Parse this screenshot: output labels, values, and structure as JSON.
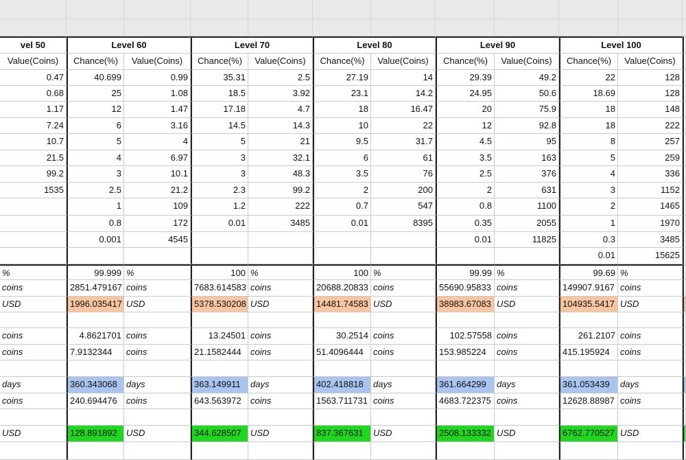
{
  "colors": {
    "header_bg": "#e9e9e9",
    "usd_highlight": "#f7c59f",
    "days_highlight": "#a9c4ee",
    "final_usd_highlight": "#1ed81e",
    "grid_line": "#c9c9c9"
  },
  "units": {
    "percent": "%",
    "coins": "coins",
    "usd": "USD",
    "days": "days"
  },
  "sheet": {
    "partial_level_label": "vel 50",
    "partial_value_header": "Value(Coins)",
    "partial_values": [
      "0.47",
      "0.68",
      "1.17",
      "7.24",
      "10.7",
      "21.5",
      "99.2",
      "1535"
    ],
    "chance_header": "Chance(%)",
    "value_header": "Value(Coins)",
    "levels": [
      {
        "label": "Level 60",
        "rows": [
          [
            "40.699",
            "0.99"
          ],
          [
            "25",
            "1.08"
          ],
          [
            "12",
            "1.47"
          ],
          [
            "6",
            "3.16"
          ],
          [
            "5",
            "4"
          ],
          [
            "4",
            "6.97"
          ],
          [
            "3",
            "10.1"
          ],
          [
            "2.5",
            "21.2"
          ],
          [
            "1",
            "109"
          ],
          [
            "0.8",
            "172"
          ],
          [
            "0.001",
            "4545"
          ],
          [
            "",
            ""
          ]
        ],
        "total_chance": "99.999",
        "coins_total": "2851.479167",
        "usd_total": "1996.035417",
        "coins_a": "4.8621701",
        "coins_b": "7.9132344",
        "days": "360.343068",
        "coins_c": "240.694476",
        "final_usd": "128.891892"
      },
      {
        "label": "Level 70",
        "rows": [
          [
            "35.31",
            "2.5"
          ],
          [
            "18.5",
            "3.92"
          ],
          [
            "17.18",
            "4.7"
          ],
          [
            "14.5",
            "14.3"
          ],
          [
            "5",
            "21"
          ],
          [
            "3",
            "32.1"
          ],
          [
            "3",
            "48.3"
          ],
          [
            "2.3",
            "99.2"
          ],
          [
            "1.2",
            "222"
          ],
          [
            "0.01",
            "3485"
          ],
          [
            "",
            ""
          ],
          [
            "",
            ""
          ]
        ],
        "total_chance": "100",
        "coins_total": "7683.614583",
        "usd_total": "5378.530208",
        "coins_a": "13.24501",
        "coins_b": "21.1582444",
        "days": "363.149911",
        "coins_c": "643.563972",
        "final_usd": "344.628507"
      },
      {
        "label": "Level 80",
        "rows": [
          [
            "27.19",
            "14"
          ],
          [
            "23.1",
            "14.2"
          ],
          [
            "18",
            "16.47"
          ],
          [
            "10",
            "22"
          ],
          [
            "9.5",
            "31.7"
          ],
          [
            "6",
            "61"
          ],
          [
            "3.5",
            "76"
          ],
          [
            "2",
            "200"
          ],
          [
            "0.7",
            "547"
          ],
          [
            "0.01",
            "8395"
          ],
          [
            "",
            ""
          ],
          [
            "",
            ""
          ]
        ],
        "total_chance": "100",
        "coins_total": "20688.20833",
        "usd_total": "14481.74583",
        "coins_a": "30.2514",
        "coins_b": "51.4096444",
        "days": "402.418818",
        "coins_c": "1563.711731",
        "final_usd": "837.367631"
      },
      {
        "label": "Level 90",
        "rows": [
          [
            "29.39",
            "49.2"
          ],
          [
            "24.95",
            "50.6"
          ],
          [
            "20",
            "75.9"
          ],
          [
            "12",
            "92.8"
          ],
          [
            "4.5",
            "95"
          ],
          [
            "3.5",
            "163"
          ],
          [
            "2.5",
            "376"
          ],
          [
            "2",
            "631"
          ],
          [
            "0.8",
            "1100"
          ],
          [
            "0.35",
            "2055"
          ],
          [
            "0.01",
            "11825"
          ],
          [
            "",
            ""
          ]
        ],
        "total_chance": "99.99",
        "coins_total": "55690.95833",
        "usd_total": "38983.67083",
        "coins_a": "102.57558",
        "coins_b": "153.985224",
        "days": "361.664299",
        "coins_c": "4683.722375",
        "final_usd": "2508.133332"
      },
      {
        "label": "Level 100",
        "rows": [
          [
            "22",
            "128"
          ],
          [
            "18.69",
            "128"
          ],
          [
            "18",
            "148"
          ],
          [
            "18",
            "222"
          ],
          [
            "8",
            "257"
          ],
          [
            "5",
            "259"
          ],
          [
            "4",
            "336"
          ],
          [
            "3",
            "1152"
          ],
          [
            "2",
            "1465"
          ],
          [
            "1",
            "1970"
          ],
          [
            "0.3",
            "3485"
          ],
          [
            "0.01",
            "15625"
          ]
        ],
        "total_chance": "99.69",
        "coins_total": "149907.9167",
        "usd_total": "104935.5417",
        "coins_a": "261.2107",
        "coins_b": "415.195924",
        "days": "361.053439",
        "coins_c": "12628.88987",
        "final_usd": "6762.770527"
      }
    ]
  }
}
